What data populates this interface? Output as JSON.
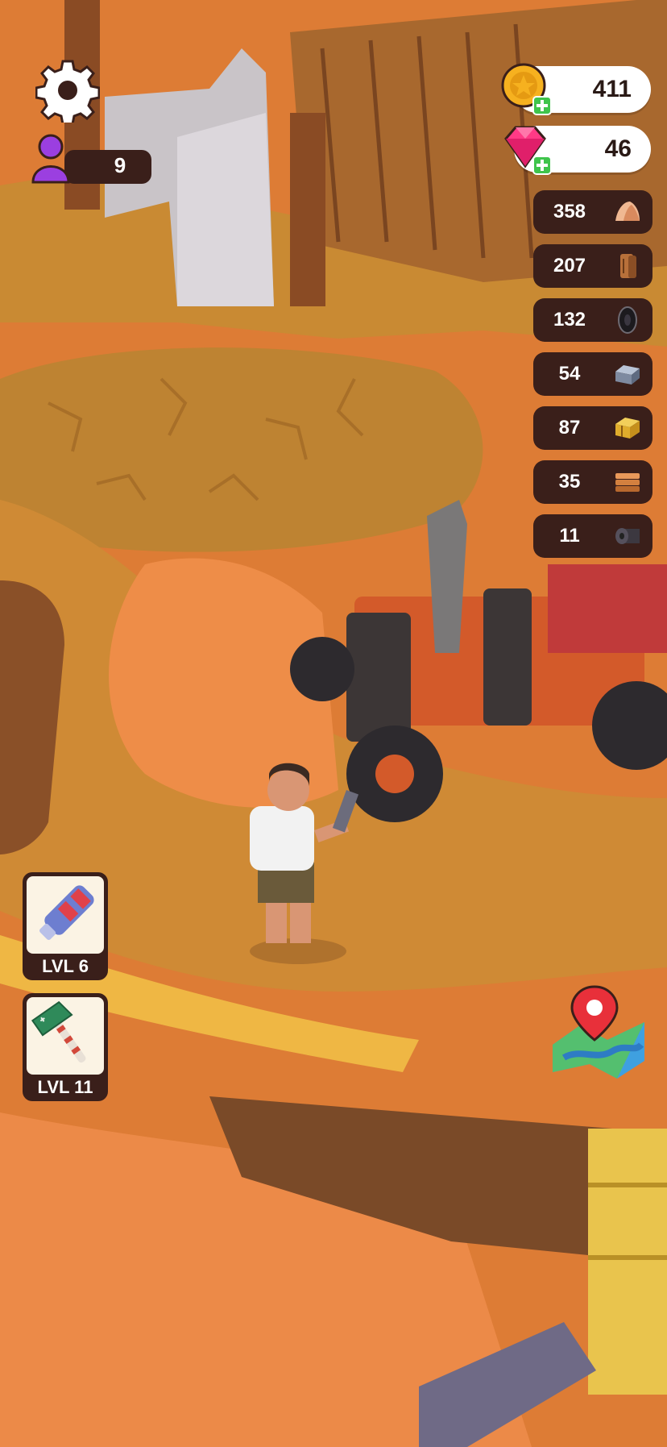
{
  "hud": {
    "player_count": "9",
    "coins": "411",
    "gems": "46"
  },
  "resources": [
    {
      "value": "358",
      "icon": "stone-icon"
    },
    {
      "value": "207",
      "icon": "wood-log-icon"
    },
    {
      "value": "132",
      "icon": "tire-icon"
    },
    {
      "value": "54",
      "icon": "metal-ingot-icon"
    },
    {
      "value": "87",
      "icon": "hay-bale-icon"
    },
    {
      "value": "35",
      "icon": "planks-icon"
    },
    {
      "value": "11",
      "icon": "cloth-roll-icon"
    }
  ],
  "tools": [
    {
      "label": "LVL 6",
      "icon": "blaster-icon"
    },
    {
      "label": "LVL 11",
      "icon": "axe-icon"
    }
  ],
  "colors": {
    "ground_orange": "#d8843a",
    "dirt_path": "#c9862f",
    "panel_dark": "#3a1f1a",
    "gem_pink": "#ff3a86",
    "coin_gold": "#f6b11f",
    "player_purple": "#9b3fe0"
  }
}
